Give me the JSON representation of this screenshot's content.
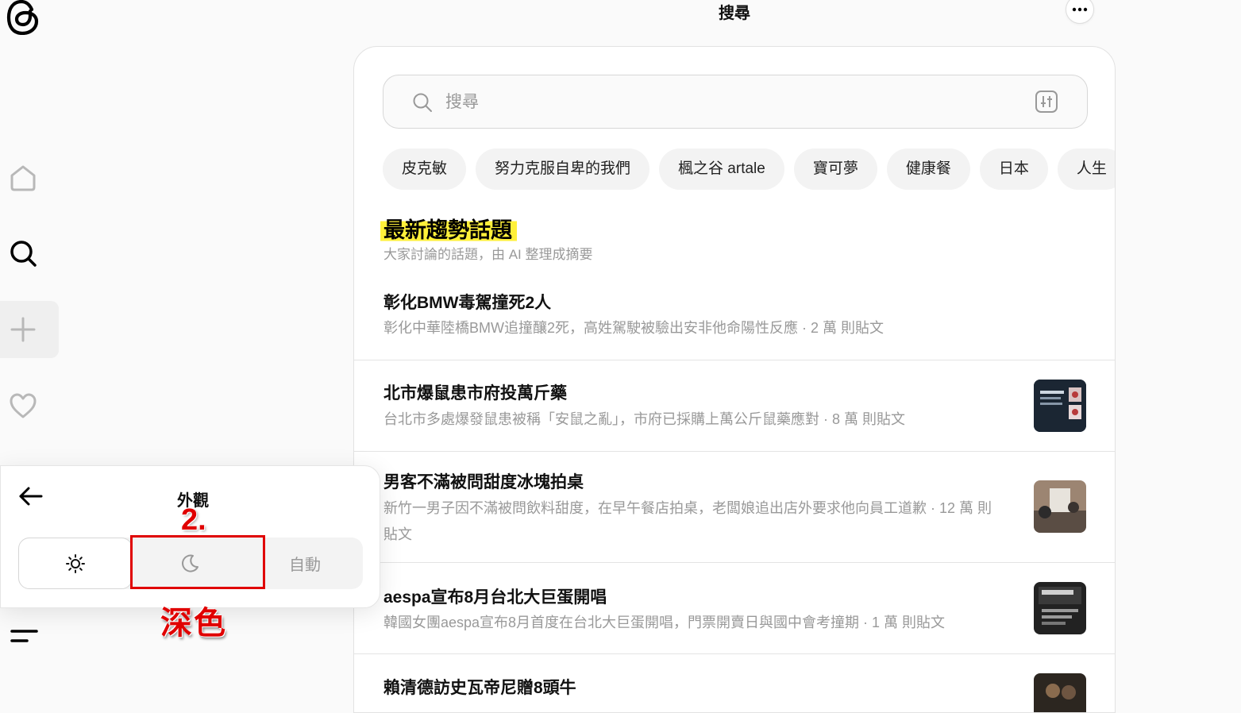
{
  "app": {
    "logo_icon": "threads-logo"
  },
  "sidebar": {
    "items": [
      {
        "name": "home",
        "icon": "home-icon"
      },
      {
        "name": "search",
        "icon": "search-icon"
      },
      {
        "name": "create",
        "icon": "plus-icon"
      },
      {
        "name": "activity",
        "icon": "heart-icon"
      },
      {
        "name": "menu",
        "icon": "menu-icon"
      }
    ]
  },
  "header": {
    "title": "搜尋",
    "more_icon": "more-icon"
  },
  "search": {
    "placeholder": "搜尋",
    "value": ""
  },
  "chips": [
    "皮克敏",
    "努力克服自卑的我們",
    "楓之谷 artale",
    "寶可夢",
    "健康餐",
    "日本",
    "人生"
  ],
  "trending": {
    "heading": "最新趨勢話題",
    "subtitle": "大家討論的話題，由 AI 整理成摘要",
    "topics": [
      {
        "title": "彰化BMW毒駕撞死2人",
        "desc": "彰化中華陸橋BMW追撞釀2死，高姓駕駛被驗出安非他命陽性反應 · 2 萬 則貼文",
        "has_thumb": false
      },
      {
        "title": "北市爆鼠患市府投萬斤藥",
        "desc": "台北市多處爆發鼠患被稱「安鼠之亂」，市府已採購上萬公斤鼠藥應對 · 8 萬 則貼文",
        "has_thumb": true
      },
      {
        "title": "男客不滿被問甜度冰塊拍桌",
        "desc": "新竹一男子因不滿被問飲料甜度，在早午餐店拍桌，老闆娘追出店外要求他向員工道歉 · 12 萬 則貼文",
        "has_thumb": true
      },
      {
        "title": "aespa宣布8月台北大巨蛋開唱",
        "desc": "韓國女團aespa宣布8月首度在台北大巨蛋開唱，門票開賣日與國中會考撞期 · 1 萬 則貼文",
        "has_thumb": true
      },
      {
        "title": "賴清德訪史瓦帝尼贈8頭牛",
        "desc": "",
        "has_thumb": true
      }
    ]
  },
  "appearance": {
    "title": "外觀",
    "modes": {
      "light_icon": "sun-icon",
      "dark_icon": "moon-icon",
      "auto_label": "自動"
    }
  },
  "annotation": {
    "step": "2.",
    "label": "深色",
    "color": "#e00000"
  }
}
